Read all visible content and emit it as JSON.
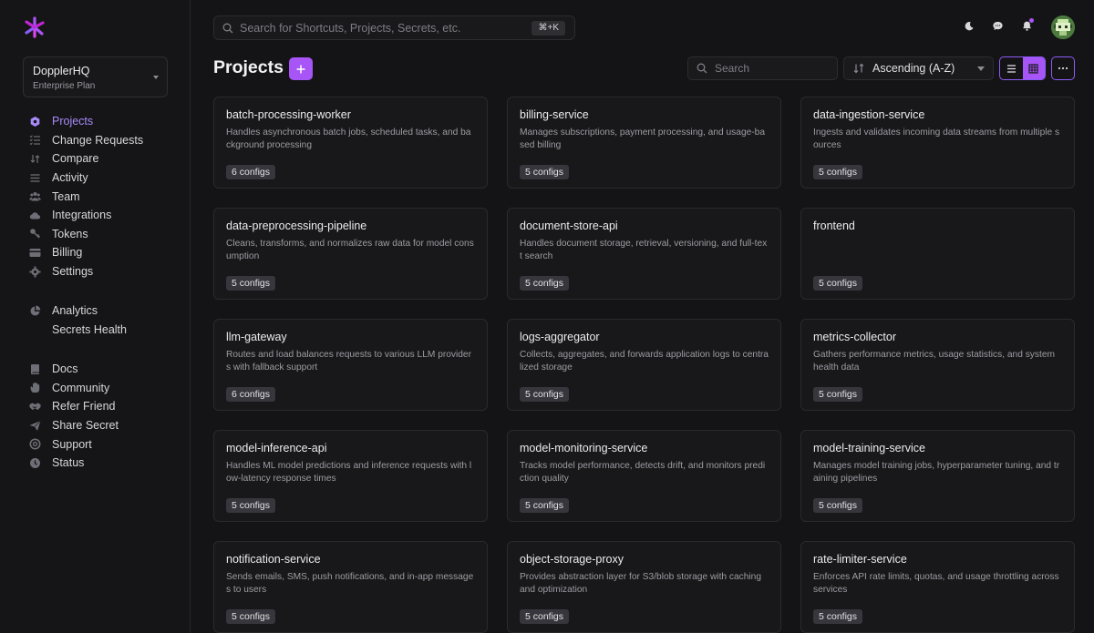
{
  "sidebar": {
    "org": {
      "name": "DopplerHQ",
      "plan": "Enterprise Plan"
    },
    "primary": [
      {
        "label": "Projects",
        "icon": "hexagon-icon",
        "active": true
      },
      {
        "label": "Change Requests",
        "icon": "list-check-icon"
      },
      {
        "label": "Compare",
        "icon": "compare-icon"
      },
      {
        "label": "Activity",
        "icon": "activity-list-icon"
      },
      {
        "label": "Team",
        "icon": "team-icon"
      },
      {
        "label": "Integrations",
        "icon": "cloud-icon"
      },
      {
        "label": "Tokens",
        "icon": "key-icon"
      },
      {
        "label": "Billing",
        "icon": "credit-card-icon"
      },
      {
        "label": "Settings",
        "icon": "gear-icon"
      }
    ],
    "secondary": [
      {
        "label": "Analytics",
        "icon": "pie-chart-icon"
      },
      {
        "label": "Secrets Health",
        "icon": ""
      }
    ],
    "tertiary": [
      {
        "label": "Docs",
        "icon": "book-icon"
      },
      {
        "label": "Community",
        "icon": "hand-wave-icon"
      },
      {
        "label": "Refer Friend",
        "icon": "handshake-icon"
      },
      {
        "label": "Share Secret",
        "icon": "paper-plane-icon"
      },
      {
        "label": "Support",
        "icon": "lifebuoy-icon"
      },
      {
        "label": "Status",
        "icon": "status-clock-icon"
      }
    ]
  },
  "topbar": {
    "search_placeholder": "Search for Shortcuts, Projects, Secrets, etc.",
    "shortcut": "⌘+K"
  },
  "header": {
    "title": "Projects",
    "filter_placeholder": "Search",
    "sort_value": "Ascending (A-Z)"
  },
  "colors": {
    "accent": "#a855f7",
    "background": "#141416",
    "card": "#18181a"
  },
  "projects": [
    {
      "name": "batch-processing-worker",
      "description": "Handles asynchronous batch jobs, scheduled tasks, and background processing",
      "configs": "6 configs"
    },
    {
      "name": "billing-service",
      "description": "Manages subscriptions, payment processing, and usage-based billing",
      "configs": "5 configs"
    },
    {
      "name": "data-ingestion-service",
      "description": "Ingests and validates incoming data streams from multiple sources",
      "configs": "5 configs"
    },
    {
      "name": "data-preprocessing-pipeline",
      "description": "Cleans, transforms, and normalizes raw data for model consumption",
      "configs": "5 configs"
    },
    {
      "name": "document-store-api",
      "description": "Handles document storage, retrieval, versioning, and full-text search",
      "configs": "5 configs"
    },
    {
      "name": "frontend",
      "description": "",
      "configs": "5 configs"
    },
    {
      "name": "llm-gateway",
      "description": "Routes and load balances requests to various LLM providers with fallback support",
      "configs": "6 configs"
    },
    {
      "name": "logs-aggregator",
      "description": "Collects, aggregates, and forwards application logs to centralized storage",
      "configs": "5 configs"
    },
    {
      "name": "metrics-collector",
      "description": "Gathers performance metrics, usage statistics, and system health data",
      "configs": "5 configs"
    },
    {
      "name": "model-inference-api",
      "description": "Handles ML model predictions and inference requests with low-latency response times",
      "configs": "5 configs"
    },
    {
      "name": "model-monitoring-service",
      "description": "Tracks model performance, detects drift, and monitors prediction quality",
      "configs": "5 configs"
    },
    {
      "name": "model-training-service",
      "description": "Manages model training jobs, hyperparameter tuning, and training pipelines",
      "configs": "5 configs"
    },
    {
      "name": "notification-service",
      "description": "Sends emails, SMS, push notifications, and in-app messages to users",
      "configs": "5 configs"
    },
    {
      "name": "object-storage-proxy",
      "description": "Provides abstraction layer for S3/blob storage with caching and optimization",
      "configs": "5 configs"
    },
    {
      "name": "rate-limiter-service",
      "description": "Enforces API rate limits, quotas, and usage throttling across services",
      "configs": "5 configs"
    }
  ]
}
